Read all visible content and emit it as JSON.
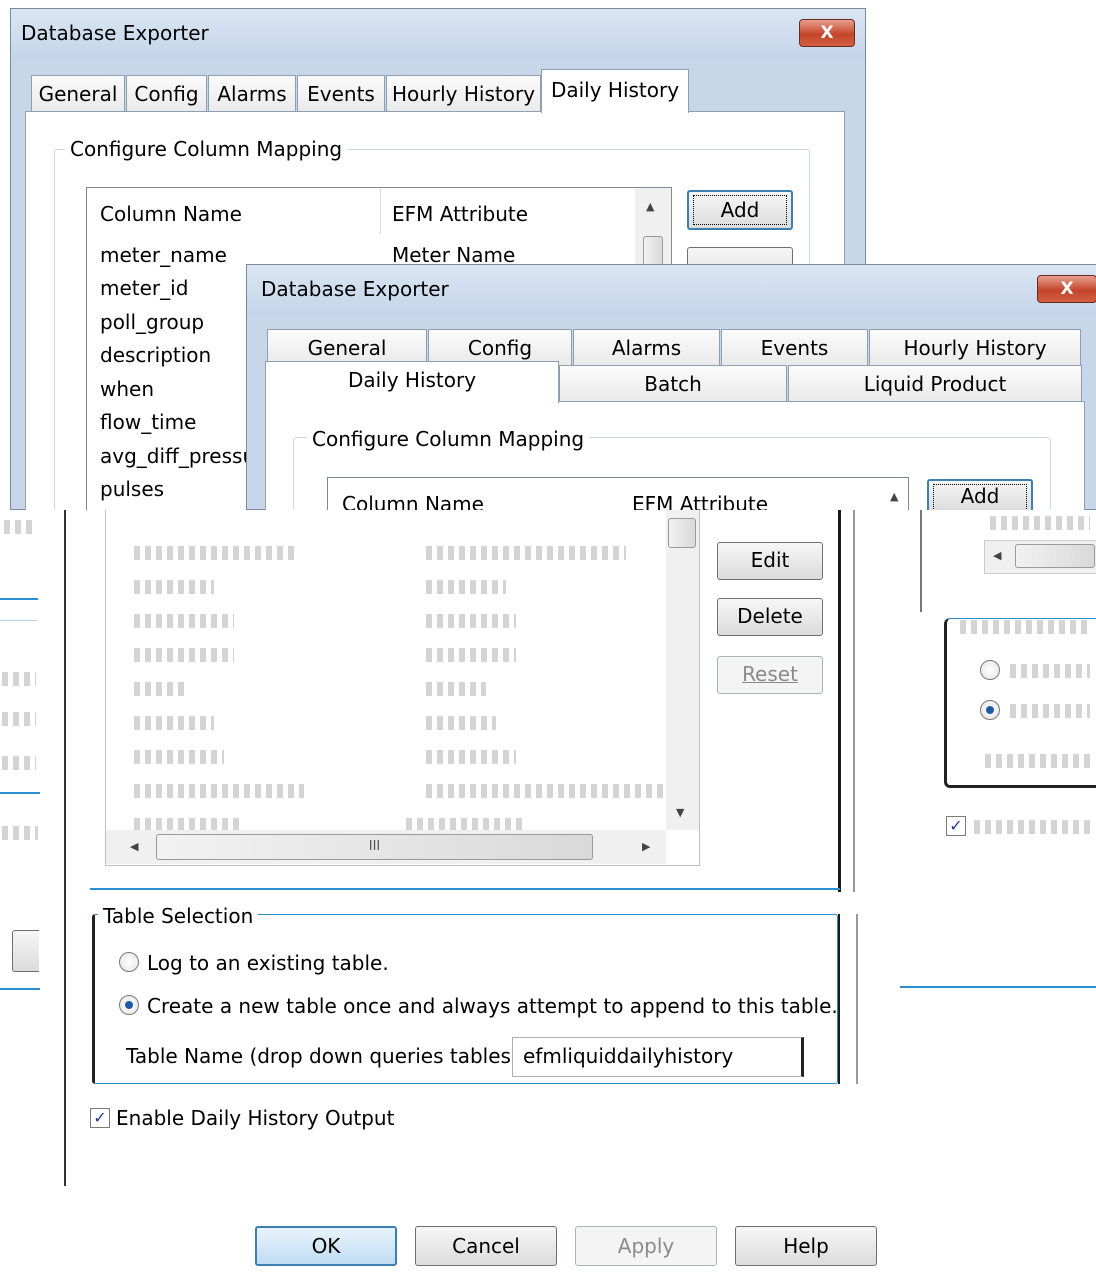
{
  "back_window": {
    "title": "Database Exporter",
    "close_label": "X",
    "tabs": [
      "General",
      "Config",
      "Alarms",
      "Events",
      "Hourly History",
      "Daily History"
    ],
    "group_label": "Configure Column Mapping",
    "columns": [
      "Column Name",
      "EFM Attribute"
    ],
    "rows": [
      [
        "meter_name",
        "Meter Name"
      ],
      [
        "meter_id",
        ""
      ],
      [
        "poll_group",
        ""
      ],
      [
        "description",
        ""
      ],
      [
        "when",
        ""
      ],
      [
        "flow_time",
        ""
      ],
      [
        "avg_diff_pressu",
        ""
      ],
      [
        "pulses",
        ""
      ]
    ],
    "add_label": "Add"
  },
  "front_window": {
    "title": "Database Exporter",
    "close_label": "X",
    "tabs_row1": [
      "General",
      "Config",
      "Alarms",
      "Events",
      "Hourly History"
    ],
    "tabs_row2": [
      "Daily History",
      "Batch",
      "Liquid Product"
    ],
    "group_label": "Configure Column Mapping",
    "columns": [
      "Column Name",
      "EFM Attribute"
    ],
    "add_label": "Add"
  },
  "lower_dialog": {
    "edit_label": "Edit",
    "delete_label": "Delete",
    "reset_label": "Reset",
    "hscroll_label": "III",
    "table_selection_label": "Table Selection",
    "radio_existing": "Log to an existing table.",
    "radio_new": "Create a new table once and always attempt to append to this table.",
    "table_name_label": "Table Name (drop down queries tables)",
    "table_name_value": "efmliquiddailyhistory",
    "enable_label": "Enable Daily History Output",
    "enable_checked": true,
    "ok_label": "OK",
    "cancel_label": "Cancel",
    "apply_label": "Apply",
    "help_label": "Help"
  },
  "colors": {
    "title_gradient_top": "#dbe6f3",
    "title_gradient_bottom": "#c4d5ea",
    "close_red": "#c3452b",
    "accent_blue": "#2a8fd0"
  }
}
